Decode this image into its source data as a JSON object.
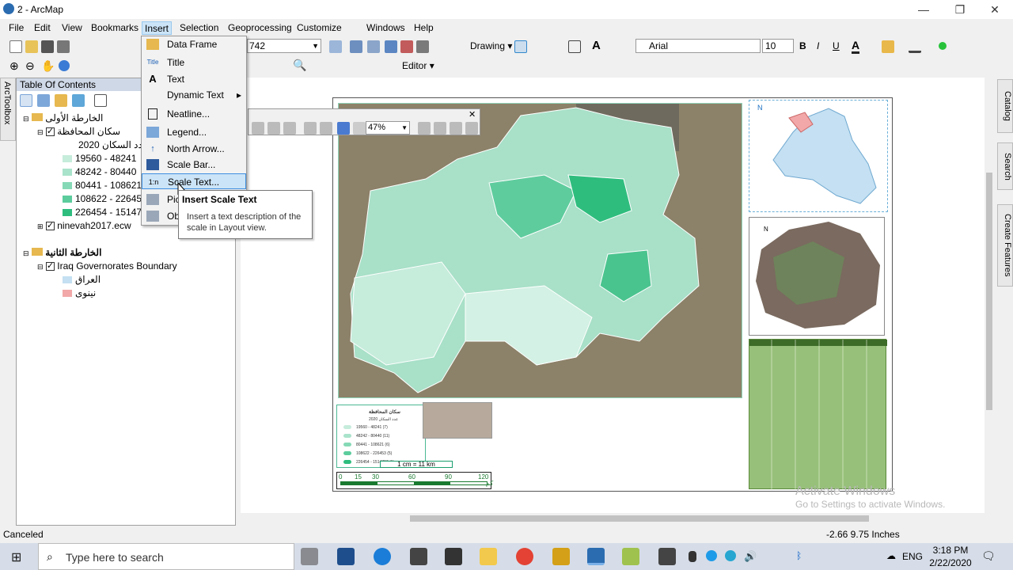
{
  "window": {
    "title": "2 - ArcMap",
    "controls": [
      "—",
      "❐",
      "✕"
    ]
  },
  "menu": {
    "items": [
      "File",
      "Edit",
      "View",
      "Bookmarks",
      "Insert",
      "Selection",
      "Geoprocessing",
      "Customize",
      "Windows",
      "Help"
    ],
    "active": "Insert"
  },
  "toolbar": {
    "scale_value": "742",
    "drawing_label": "Drawing",
    "font_name": "Arial",
    "font_size": "10",
    "bold": "B",
    "italic": "I",
    "underline": "U",
    "editor_label": "Editor",
    "zoom_value": "47%"
  },
  "toc": {
    "header": "Table Of Contents",
    "frame1": {
      "name": "الخارطة الأولى",
      "layer": "سكان المحافظة",
      "field": "عدد السكان 2020",
      "classes": [
        {
          "label": "19560 - 48241",
          "color": "#c6ecdc"
        },
        {
          "label": "48242 - 80440",
          "color": "#a9e3cb"
        },
        {
          "label": "80441 - 108621",
          "color": "#86d9b6"
        },
        {
          "label": "108622 - 226453",
          "color": "#5ccc9d"
        },
        {
          "label": "226454 - 1514787",
          "color": "#2fbd7e"
        }
      ],
      "raster": "ninevah2017.ecw"
    },
    "frame2": {
      "name": "الخارطة الثانية",
      "layer": "Iraq Governorates Boundary",
      "items": [
        {
          "label": "العراق",
          "color": "#c4e0f2"
        },
        {
          "label": "نينوى",
          "color": "#f2a8a8"
        }
      ]
    }
  },
  "insert_menu": {
    "items": [
      {
        "label": "Data Frame",
        "icon": "data-frame-icon"
      },
      {
        "label": "Title",
        "icon": "title-icon"
      },
      {
        "label": "Text",
        "icon": "text-icon"
      },
      {
        "label": "Dynamic Text",
        "icon": "dynamic-text-icon",
        "submenu": true
      },
      {
        "label": "Neatline...",
        "icon": "neatline-icon"
      },
      {
        "label": "Legend...",
        "icon": "legend-icon"
      },
      {
        "label": "North Arrow...",
        "icon": "north-arrow-icon"
      },
      {
        "label": "Scale Bar...",
        "icon": "scale-bar-icon"
      },
      {
        "label": "Scale Text...",
        "icon": "scale-text-icon",
        "highlighted": true
      },
      {
        "label": "Pic",
        "icon": "picture-icon"
      },
      {
        "label": "Ob",
        "icon": "object-icon"
      }
    ]
  },
  "tooltip": {
    "title": "Insert Scale Text",
    "body": "Insert a text description of the scale in Layout view."
  },
  "layout": {
    "scale_text": "1 cm = 11 km",
    "scale_ticks": [
      "0",
      "15",
      "30",
      "60",
      "90",
      "120"
    ],
    "scale_unit": "كم",
    "legend_title": "سكان المحافظة",
    "legend_sub": "عدد السكان 2020",
    "legend_rows": [
      "19560 - 48241 (7)",
      "48242 - 80440 (11)",
      "80441 - 108621 (6)",
      "108622 - 226453 (5)",
      "226454 - 1514787 (1)"
    ],
    "inset_n": "N",
    "inset2_n": "N"
  },
  "side_tabs": {
    "left": "ArcToolbox",
    "right": [
      "Catalog",
      "Search",
      "Create Features"
    ]
  },
  "status": {
    "left": "Canceled",
    "coords": "-2.66  9.75 Inches"
  },
  "watermark": {
    "line1": "Activate Windows",
    "line2": "Go to Settings to activate Windows."
  },
  "taskbar": {
    "search_placeholder": "Type here to search",
    "time": "3:18 PM",
    "date": "2/22/2020",
    "lang": "ENG"
  }
}
